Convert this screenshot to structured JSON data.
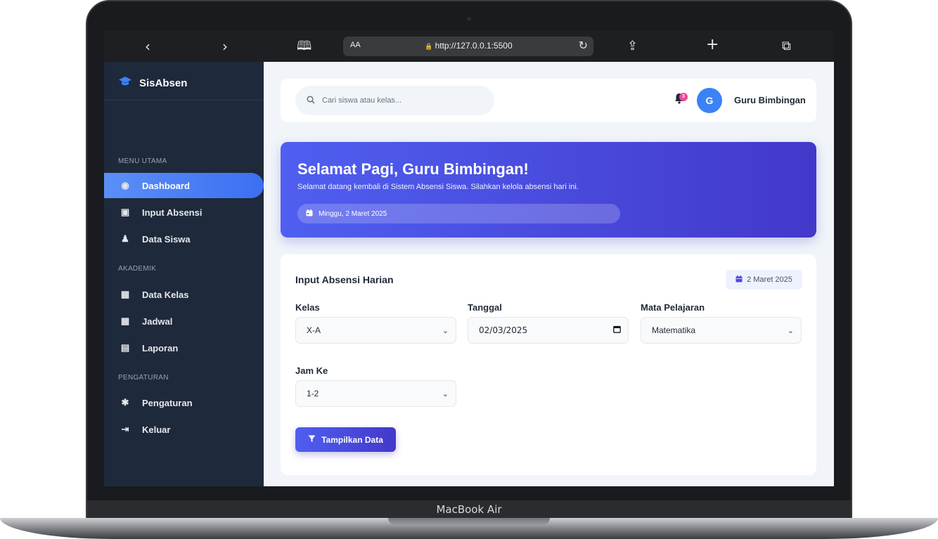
{
  "device": {
    "label": "MacBook Air"
  },
  "browser": {
    "back_icon": "chevron-left-icon",
    "forward_icon": "chevron-right-icon",
    "aa_label": "AA",
    "url": "http://127.0.0.1:5500",
    "back_glyph": "‹",
    "forward_glyph": "›",
    "book_glyph": "🕮",
    "reload_glyph": "↻",
    "share_glyph": "⇪",
    "plus_glyph": "+",
    "tabs_glyph": "⧉",
    "lock_glyph": "🔒"
  },
  "sidebar": {
    "brand_name": "SisAbsen",
    "brand_icon": "graduation-cap-icon",
    "sections": [
      {
        "title": "MENU UTAMA"
      },
      {
        "title": "AKADEMIK"
      },
      {
        "title": "PENGATURAN"
      }
    ],
    "items": [
      {
        "label": "Dashboard",
        "icon": "gauge-icon",
        "glyph": "◉",
        "active": true
      },
      {
        "label": "Input Absensi",
        "icon": "clipboard-icon",
        "glyph": "▣"
      },
      {
        "label": "Data Siswa",
        "icon": "user-graduate-icon",
        "glyph": "♟"
      },
      {
        "label": "Data Kelas",
        "icon": "school-icon",
        "glyph": "▦"
      },
      {
        "label": "Jadwal",
        "icon": "calendar-icon",
        "glyph": "▦"
      },
      {
        "label": "Laporan",
        "icon": "file-icon",
        "glyph": "▤"
      },
      {
        "label": "Pengaturan",
        "icon": "gear-icon",
        "glyph": "✱"
      },
      {
        "label": "Keluar",
        "icon": "sign-out-icon",
        "glyph": "⇥"
      }
    ]
  },
  "topbar": {
    "search_placeholder": "Cari siswa atau kelas...",
    "notification_count": "3",
    "avatar_initial": "G",
    "user_name": "Guru Bimbingan"
  },
  "banner": {
    "title": "Selamat Pagi, Guru Bimbingan!",
    "subtitle": "Selamat datang kembali di Sistem Absensi Siswa. Silahkan kelola absensi hari ini.",
    "date": "Minggu, 2 Maret 2025"
  },
  "form": {
    "title": "Input Absensi Harian",
    "date_chip": "2 Maret 2025",
    "fields": {
      "kelas": {
        "label": "Kelas",
        "value": "X-A"
      },
      "tanggal": {
        "label": "Tanggal",
        "value": "02/03/2025"
      },
      "mapel": {
        "label": "Mata Pelajaran",
        "value": "Matematika"
      },
      "jam": {
        "label": "Jam Ke",
        "value": "1-2"
      }
    },
    "submit_label": "Tampilkan Data"
  },
  "colors": {
    "sidebar_bg": "#1e293b",
    "accent": "#4f5ff0",
    "accent_dark": "#4338ca",
    "badge": "#ec4899",
    "avatar": "#3b82f6"
  }
}
